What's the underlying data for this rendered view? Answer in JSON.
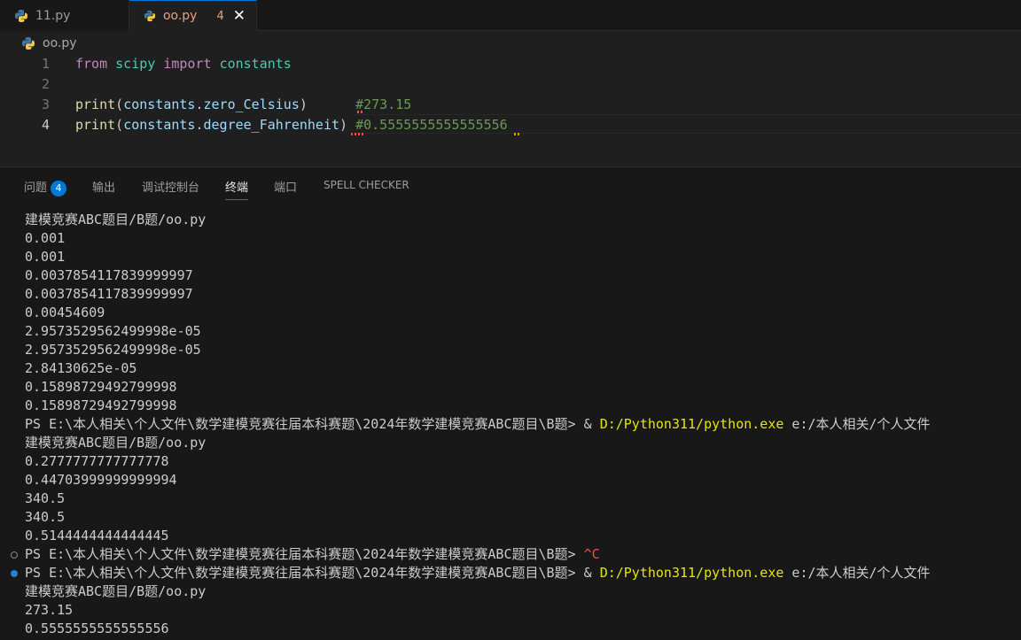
{
  "tabs": [
    {
      "label": "11.py",
      "active": false
    },
    {
      "label": "oo.py",
      "active": true,
      "problems": "4"
    }
  ],
  "breadcrumb": "oo.py",
  "editor": {
    "lines": [
      {
        "number": "1",
        "parts": [
          [
            "kw-import",
            "from"
          ],
          [
            "plain",
            " "
          ],
          [
            "mod",
            "scipy"
          ],
          [
            "plain",
            " "
          ],
          [
            "kw-import",
            "import"
          ],
          [
            "plain",
            " "
          ],
          [
            "mod",
            "constants"
          ]
        ]
      },
      {
        "number": "2",
        "parts": []
      },
      {
        "number": "3",
        "parts": [
          [
            "fn",
            "print"
          ],
          [
            "plain",
            "("
          ],
          [
            "var",
            "constants"
          ],
          [
            "plain",
            "."
          ],
          [
            "var",
            "zero_Celsius"
          ],
          [
            "plain",
            ")"
          ],
          [
            "plain",
            "      "
          ],
          [
            "com",
            "#273.15"
          ]
        ]
      },
      {
        "number": "4",
        "parts": [
          [
            "fn",
            "print"
          ],
          [
            "plain",
            "("
          ],
          [
            "var",
            "constants"
          ],
          [
            "plain",
            "."
          ],
          [
            "var",
            "degree_Fahrenheit"
          ],
          [
            "plain",
            ")"
          ],
          [
            "plain",
            " "
          ],
          [
            "com",
            "#0.5555555555555556"
          ]
        ]
      }
    ]
  },
  "panel": {
    "tabs": [
      {
        "label": "问题",
        "badge": "4"
      },
      {
        "label": "输出"
      },
      {
        "label": "调试控制台"
      },
      {
        "label": "终端",
        "active": true
      },
      {
        "label": "端口"
      },
      {
        "label": "SPELL CHECKER"
      }
    ],
    "terminal": [
      {
        "segs": [
          [
            "",
            "建模竞赛ABC题目/B题/oo.py"
          ]
        ]
      },
      {
        "segs": [
          [
            "",
            "0.001"
          ]
        ]
      },
      {
        "segs": [
          [
            "",
            "0.001"
          ]
        ]
      },
      {
        "segs": [
          [
            "",
            "0.0037854117839999997"
          ]
        ]
      },
      {
        "segs": [
          [
            "",
            "0.0037854117839999997"
          ]
        ]
      },
      {
        "segs": [
          [
            "",
            "0.00454609"
          ]
        ]
      },
      {
        "segs": [
          [
            "",
            "2.9573529562499998e-05"
          ]
        ]
      },
      {
        "segs": [
          [
            "",
            "2.9573529562499998e-05"
          ]
        ]
      },
      {
        "segs": [
          [
            "",
            "2.84130625e-05"
          ]
        ]
      },
      {
        "segs": [
          [
            "",
            "0.15898729492799998"
          ]
        ]
      },
      {
        "segs": [
          [
            "",
            "0.15898729492799998"
          ]
        ]
      },
      {
        "segs": [
          [
            "",
            "PS E:\\本人相关\\个人文件\\数学建模竞赛往届本科赛题\\2024年数学建模竞赛ABC题目\\B题> & "
          ],
          [
            "yel",
            "D:/Python311/python.exe"
          ],
          [
            "",
            " e:/本人相关/个人文件"
          ]
        ]
      },
      {
        "segs": [
          [
            "",
            "建模竞赛ABC题目/B题/oo.py"
          ]
        ]
      },
      {
        "segs": [
          [
            "",
            "0.2777777777777778"
          ]
        ]
      },
      {
        "segs": [
          [
            "",
            "0.44703999999999994"
          ]
        ]
      },
      {
        "segs": [
          [
            "",
            "340.5"
          ]
        ]
      },
      {
        "segs": [
          [
            "",
            "340.5"
          ]
        ]
      },
      {
        "segs": [
          [
            "",
            "0.5144444444444445"
          ]
        ]
      },
      {
        "dot": "hollow",
        "segs": [
          [
            "",
            "PS E:\\本人相关\\个人文件\\数学建模竞赛往届本科赛题\\2024年数学建模竞赛ABC题目\\B题> "
          ],
          [
            "red",
            "^C"
          ]
        ]
      },
      {
        "dot": "blue",
        "segs": [
          [
            "",
            "PS E:\\本人相关\\个人文件\\数学建模竞赛往届本科赛题\\2024年数学建模竞赛ABC题目\\B题> & "
          ],
          [
            "yel",
            "D:/Python311/python.exe"
          ],
          [
            "",
            " e:/本人相关/个人文件"
          ]
        ]
      },
      {
        "segs": [
          [
            "",
            "建模竞赛ABC题目/B题/oo.py"
          ]
        ]
      },
      {
        "segs": [
          [
            "",
            "273.15"
          ]
        ]
      },
      {
        "segs": [
          [
            "",
            "0.5555555555555556"
          ]
        ]
      }
    ]
  },
  "colors": {
    "accent": "#0078d4",
    "tab_modified": "#e8a080",
    "error": "#f14c4c"
  }
}
